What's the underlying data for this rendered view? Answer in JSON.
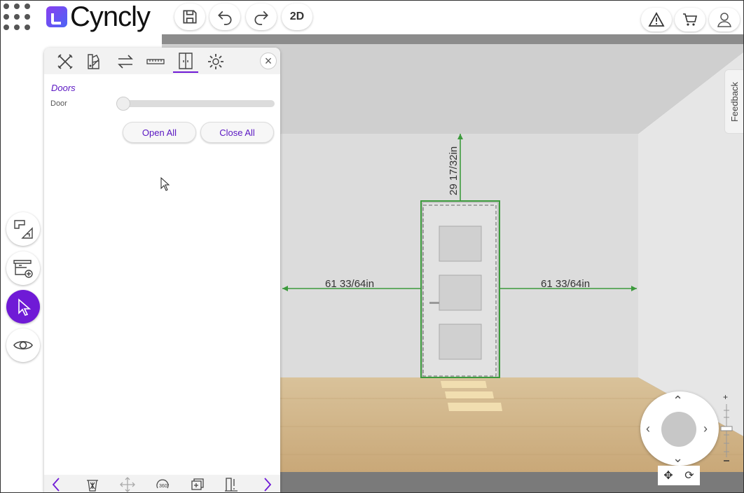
{
  "header": {
    "brand": "Cyncly",
    "view_toggle_label": "2D"
  },
  "panel": {
    "section_title": "Doors",
    "row_label": "Door",
    "slider_value": 0,
    "open_all_label": "Open All",
    "close_all_label": "Close All",
    "tabs": [
      "tools-icon",
      "palette-icon",
      "swap-icon",
      "ruler-icon",
      "door-icon",
      "gear-icon"
    ],
    "active_tab": "door-icon"
  },
  "scene": {
    "height_dimension": "29 17/32in",
    "left_dimension": "61 33/64in",
    "right_dimension": "61 33/64in"
  },
  "feedback_label": "Feedback",
  "colors": {
    "accent": "#6f1ad6",
    "dimension_line": "#3c9a3c"
  }
}
